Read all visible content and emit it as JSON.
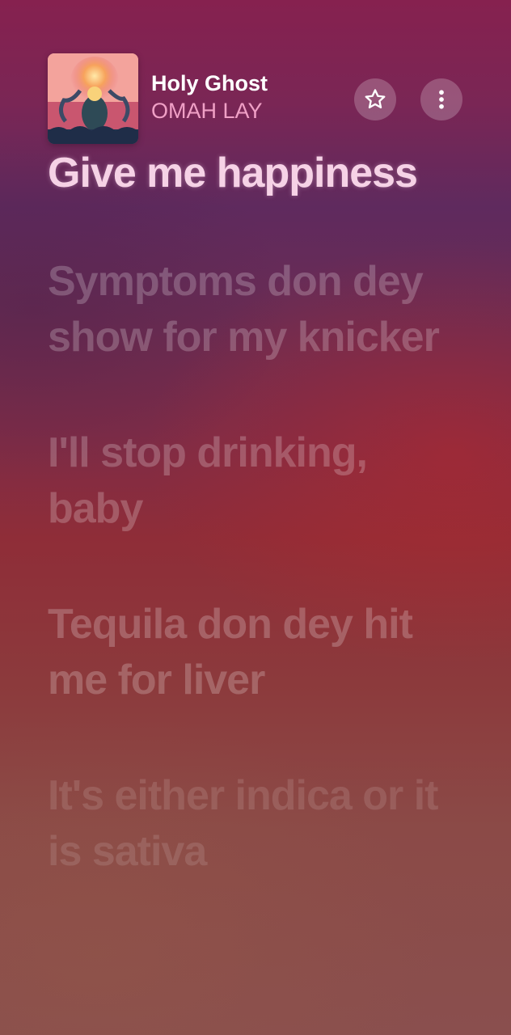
{
  "now_playing": {
    "title": "Holy Ghost",
    "artist": "OMAH LAY",
    "artwork_icon": "album-artwork"
  },
  "actions": {
    "favorite_icon": "star-icon",
    "more_icon": "more-vertical-icon"
  },
  "lyrics": {
    "active": "Give me happiness",
    "upcoming": [
      "Symptoms don dey show for my knicker",
      "I'll stop drinking, baby",
      "Tequila don dey hit me for liver",
      "It's either indica or it is sativa"
    ]
  },
  "colors": {
    "accent_artist": "#f0a0c6",
    "active_lyric": "#f6d2e6"
  }
}
